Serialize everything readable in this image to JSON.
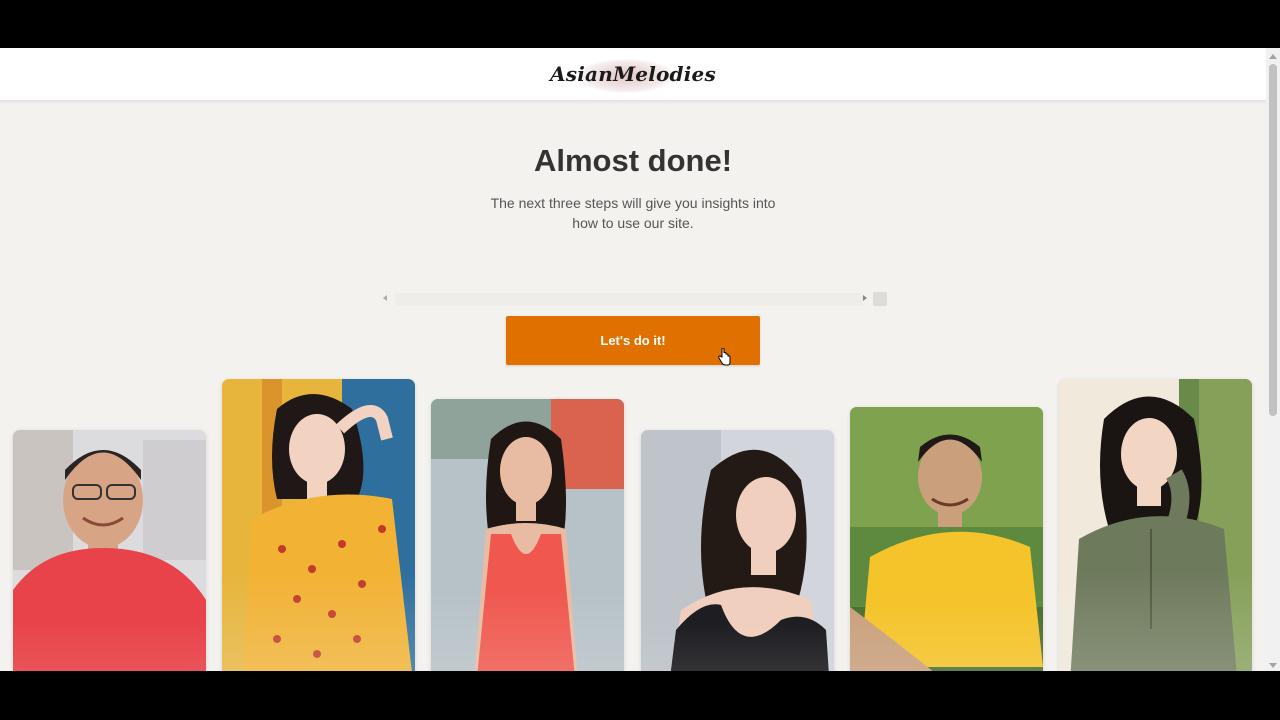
{
  "brand": {
    "name": "AsianMelodies"
  },
  "onboarding": {
    "title": "Almost done!",
    "subtitle": "The next three steps will give you insights into how to use our site.",
    "cta_label": "Let's do it!"
  },
  "colors": {
    "accent": "#e07000",
    "background": "#f3f2ef",
    "title": "#333333"
  },
  "profiles": [
    {
      "name": "profile-man-red-shirt",
      "shirt": "#e8434a"
    },
    {
      "name": "profile-woman-yellow-dress",
      "shirt": "#f2b233"
    },
    {
      "name": "profile-woman-coral-dress",
      "shirt": "#f0584f"
    },
    {
      "name": "profile-woman-black-top",
      "shirt": "#1e1e22"
    },
    {
      "name": "profile-man-yellow-shirt",
      "shirt": "#f5c42a"
    },
    {
      "name": "profile-woman-green-sweater",
      "shirt": "#6e7a5c"
    }
  ]
}
